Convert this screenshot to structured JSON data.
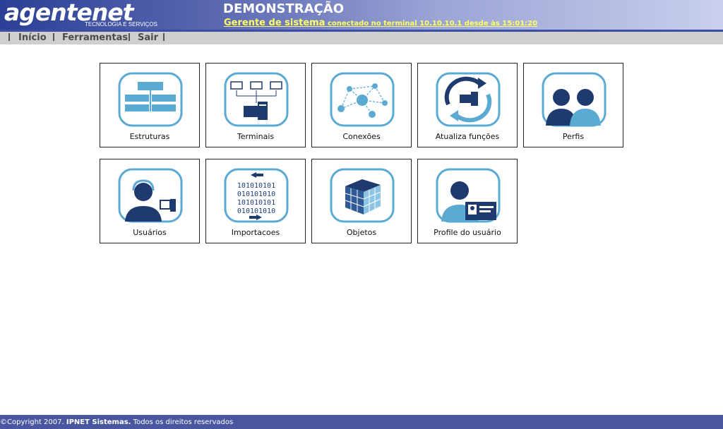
{
  "header": {
    "logo_main_bold": "agente",
    "logo_main_rest": "net",
    "logo_sub": "TECNOLOGIA E SERVIÇOS",
    "title": "DEMONSTRAÇÃO",
    "role": "Gerente de sistema",
    "connection": " conectado no terminal 10.10.10.1 desde às 15:01:20"
  },
  "menu": {
    "items": [
      {
        "label": "Início"
      },
      {
        "label": "Ferramentas"
      },
      {
        "label": "Sair"
      }
    ]
  },
  "tiles": [
    {
      "label": "Estruturas",
      "icon": "structure-icon"
    },
    {
      "label": "Terminais",
      "icon": "terminals-icon"
    },
    {
      "label": "Conexões",
      "icon": "network-icon"
    },
    {
      "label": "Atualiza funções",
      "icon": "refresh-computer-icon"
    },
    {
      "label": "Perfis",
      "icon": "people-icon"
    },
    {
      "label": "Usuários",
      "icon": "user-headset-icon"
    },
    {
      "label": "Importacoes",
      "icon": "binary-import-icon"
    },
    {
      "label": "Objetos",
      "icon": "cube-icon"
    },
    {
      "label": "Profile do usuário",
      "icon": "user-id-card-icon"
    }
  ],
  "binary_lines": [
    "101010101",
    "010101010",
    "101010101",
    "010101010"
  ],
  "footer": {
    "copyright": "©Copyright 2007. ",
    "company": "IPNET Sistemas.",
    "rights": " Todos os direitos reservados"
  },
  "colors": {
    "header_dark": "#2b3f96",
    "header_light": "#c9cfec",
    "accent_yellow": "#ffff66",
    "icon_blue": "#5aaad4",
    "icon_dark": "#1f3a6e",
    "footer": "#4a57a0"
  }
}
